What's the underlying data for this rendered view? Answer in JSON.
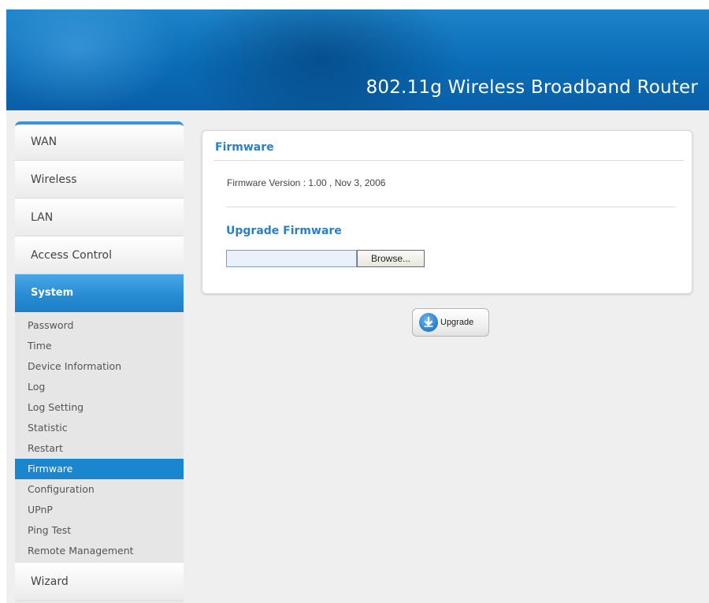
{
  "header": {
    "title": "802.11g Wireless Broadband Router"
  },
  "sidebar": {
    "items": [
      {
        "label": "WAN"
      },
      {
        "label": "Wireless"
      },
      {
        "label": "LAN"
      },
      {
        "label": "Access Control"
      },
      {
        "label": "System"
      }
    ],
    "system_subitems": [
      {
        "label": "Password"
      },
      {
        "label": "Time"
      },
      {
        "label": "Device Information"
      },
      {
        "label": "Log"
      },
      {
        "label": "Log Setting"
      },
      {
        "label": "Statistic"
      },
      {
        "label": "Restart"
      },
      {
        "label": "Firmware"
      },
      {
        "label": "Configuration"
      },
      {
        "label": "UPnP"
      },
      {
        "label": "Ping Test"
      },
      {
        "label": "Remote Management"
      }
    ],
    "last_item": {
      "label": "Wizard"
    },
    "active_item": "System",
    "active_subitem": "Firmware"
  },
  "content": {
    "section_title": "Firmware",
    "firmware_version": "Firmware Version : 1.00 , Nov 3, 2006",
    "upgrade_title": "Upgrade Firmware",
    "file_input_value": "",
    "browse_label": "Browse...",
    "upgrade_button_label": "Upgrade",
    "upgrade_icon": "download-arrow-icon"
  },
  "colors": {
    "accent": "#2b7fc4",
    "active_menu": "#1b86d0",
    "banner": "#0a6cb6"
  }
}
